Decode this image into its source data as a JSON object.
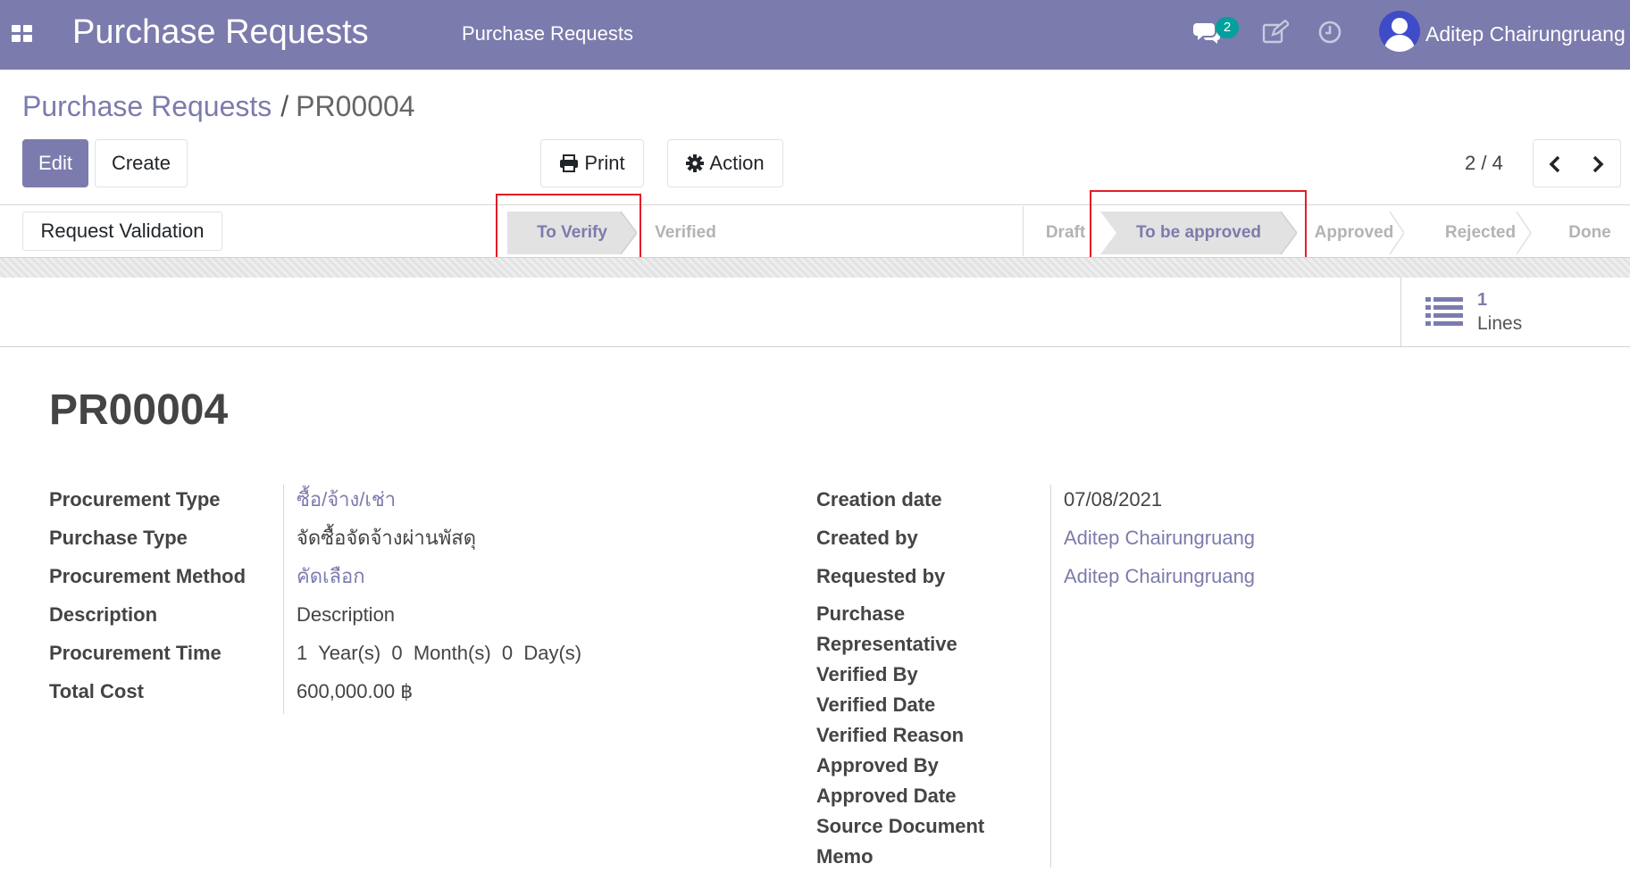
{
  "navbar": {
    "brand": "Purchase Requests",
    "menu": [
      "Purchase Requests"
    ],
    "chat_badge": "2",
    "user_name": "Aditep Chairungruang",
    "icons": [
      "apps-icon",
      "chat-icon",
      "edit-icon",
      "clock-icon",
      "avatar"
    ]
  },
  "breadcrumb": {
    "parent": "Purchase Requests",
    "separator": "/",
    "current": "PR00004"
  },
  "toolbar": {
    "edit_label": "Edit",
    "create_label": "Create",
    "print_label": "Print",
    "action_label": "Action",
    "pager_value": "2 / 4"
  },
  "statusbar": {
    "request_button": "Request Validation",
    "verify_stages": [
      {
        "label": "To Verify",
        "active": true
      },
      {
        "label": "Verified",
        "active": false
      }
    ],
    "approval_stages": [
      {
        "label": "Draft",
        "active": false
      },
      {
        "label": "To be approved",
        "active": true
      },
      {
        "label": "Approved",
        "active": false
      },
      {
        "label": "Rejected",
        "active": false
      },
      {
        "label": "Done",
        "active": false
      }
    ]
  },
  "smart_button": {
    "count": "1",
    "label": "Lines"
  },
  "record": {
    "title": "PR00004",
    "left_fields": [
      {
        "label": "Procurement Type",
        "value": "ซื้อ/จ้าง/เช่า",
        "link": true
      },
      {
        "label": "Purchase Type",
        "value": "จัดซื้อจัดจ้างผ่านพัสดุ",
        "link": false
      },
      {
        "label": "Procurement Method",
        "value": "คัดเลือก",
        "link": true
      },
      {
        "label": "Description",
        "value": "Description",
        "link": false
      },
      {
        "label": "Procurement Time",
        "value": "1  Year(s)  0  Month(s)  0  Day(s)",
        "link": false
      },
      {
        "label": "Total Cost",
        "value": "600,000.00 ฿",
        "link": false
      }
    ],
    "right_fields": [
      {
        "label": "Creation date",
        "value": "07/08/2021",
        "link": false
      },
      {
        "label": "Created by",
        "value": "Aditep Chairungruang",
        "link": true
      },
      {
        "label": "Requested by",
        "value": "Aditep Chairungruang",
        "link": true
      }
    ],
    "purchase_rep_label": [
      "Purchase",
      "Representative"
    ],
    "right_labels_more": [
      "Verified By",
      "Verified Date",
      "Verified Reason",
      "Approved By",
      "Approved Date",
      "Source Document",
      "Memo"
    ]
  },
  "colors": {
    "brand": "#7c7bad",
    "badge": "#00a09d",
    "highlight": "#e21e26"
  }
}
